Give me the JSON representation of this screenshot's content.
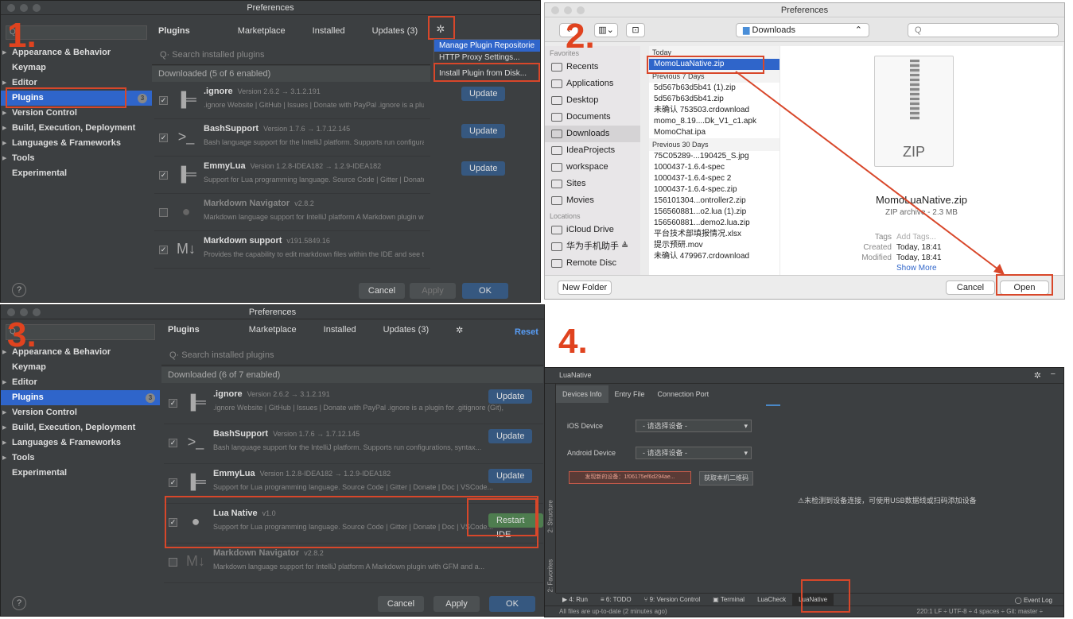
{
  "steps": {
    "s1": "1.",
    "s2": "2.",
    "s3": "3.",
    "s4": "4."
  },
  "prefs1": {
    "title": "Preferences",
    "search_placeholder": "Q",
    "sidebar": [
      {
        "label": "Appearance & Behavior",
        "arrow": true
      },
      {
        "label": "Keymap",
        "arrow": false
      },
      {
        "label": "Editor",
        "arrow": true
      },
      {
        "label": "Plugins",
        "arrow": false,
        "selected": true,
        "badge": "3"
      },
      {
        "label": "Version Control",
        "arrow": true
      },
      {
        "label": "Build, Execution, Deployment",
        "arrow": true
      },
      {
        "label": "Languages & Frameworks",
        "arrow": true
      },
      {
        "label": "Tools",
        "arrow": true
      },
      {
        "label": "Experimental",
        "arrow": false
      }
    ],
    "tabs": {
      "plugins": "Plugins",
      "marketplace": "Marketplace",
      "installed": "Installed",
      "updates": "Updates (3)"
    },
    "menu": [
      "Manage Plugin Repositorie",
      "HTTP Proxy Settings...",
      "Install Plugin from Disk..."
    ],
    "search": "Q· Search installed plugins",
    "subheader": "Downloaded (5 of 6 enabled)",
    "plugins": [
      {
        "name": ".ignore",
        "version": "Version 2.6.2 → 3.1.2.191",
        "desc": ".ignore Website | GitHub | Issues | Donate with PayPal .ignore is a plugin for .gitignore (Git),",
        "update": "Update",
        "checked": "✓"
      },
      {
        "name": "BashSupport",
        "version": "Version 1.7.6 → 1.7.12.145",
        "desc": "Bash language support for the IntelliJ platform. Supports run configurations, syntax...",
        "update": "Update",
        "checked": "✓"
      },
      {
        "name": "EmmyLua",
        "version": "Version 1.2.8-IDEA182 → 1.2.9-IDEA182",
        "desc": "Support for Lua programming language. Source Code | Gitter | Donate | Doc | VSCode...",
        "update": "Update",
        "checked": "✓"
      },
      {
        "name": "Markdown Navigator",
        "version": "v2.8.2",
        "desc": "Markdown language support for IntelliJ platform A Markdown plugin with GFM and a...",
        "update": "",
        "checked": ""
      },
      {
        "name": "Markdown support",
        "version": "v191.5849.16",
        "desc": "Provides the capability to edit markdown files within the IDE and see the rendered HTML in",
        "update": "",
        "checked": "✓"
      }
    ],
    "help": "?",
    "cancel": "Cancel",
    "apply": "Apply",
    "ok": "OK"
  },
  "finder": {
    "title": "Preferences",
    "location": "Downloads",
    "search_icon": "Q",
    "favorites_hd": "Favorites",
    "favorites": [
      "Recents",
      "Applications",
      "Desktop",
      "Documents",
      "Downloads",
      "IdeaProjects",
      "workspace",
      "Sites",
      "Movies"
    ],
    "locations_hd": "Locations",
    "locations": [
      "iCloud Drive",
      "华为手机助手 ≜",
      "Remote Disc"
    ],
    "today_hd": "Today",
    "today": [
      "MomoLuaNative.zip"
    ],
    "week_hd": "Previous 7 Days",
    "week": [
      "5d567b63d5b41 (1).zip",
      "5d567b63d5b41.zip",
      "未确认 753503.crdownload",
      "momo_8.19....Dk_V1_c1.apk",
      "MomoChat.ipa"
    ],
    "month_hd": "Previous 30 Days",
    "month": [
      "75C05289-...190425_S.jpg",
      "1000437-1.6.4-spec",
      "1000437-1.6.4-spec 2",
      "1000437-1.6.4-spec.zip",
      "156101304...ontroller2.zip",
      "156560881...o2.lua (1).zip",
      "156560881...demo2.lua.zip",
      "平台技术部填报情况.xlsx",
      "提示预研.mov",
      "未确认 479967.crdownload"
    ],
    "preview_label": "ZIP",
    "preview_name": "MomoLuaNative.zip",
    "preview_kind": "ZIP archive - 2.3 MB",
    "tags_k": "Tags",
    "tags_v": "Add Tags...",
    "created_k": "Created",
    "created_v": "Today, 18:41",
    "modified_k": "Modified",
    "modified_v": "Today, 18:41",
    "show_more": "Show More",
    "new_folder": "New Folder",
    "cancel": "Cancel",
    "open": "Open"
  },
  "prefs3": {
    "title": "Preferences",
    "search_placeholder": "Q",
    "sidebar": [
      {
        "label": "Appearance & Behavior",
        "arrow": true
      },
      {
        "label": "Keymap",
        "arrow": false
      },
      {
        "label": "Editor",
        "arrow": true
      },
      {
        "label": "Plugins",
        "arrow": false,
        "selected": true,
        "badge": "3"
      },
      {
        "label": "Version Control",
        "arrow": true
      },
      {
        "label": "Build, Execution, Deployment",
        "arrow": true
      },
      {
        "label": "Languages & Frameworks",
        "arrow": true
      },
      {
        "label": "Tools",
        "arrow": true
      },
      {
        "label": "Experimental",
        "arrow": false
      }
    ],
    "tabs": {
      "plugins": "Plugins",
      "marketplace": "Marketplace",
      "installed": "Installed",
      "updates": "Updates (3)",
      "reset": "Reset"
    },
    "search": "Q· Search installed plugins",
    "subheader": "Downloaded (6 of 7 enabled)",
    "plugins": [
      {
        "name": ".ignore",
        "version": "Version 2.6.2 → 3.1.2.191",
        "desc": ".ignore Website | GitHub | Issues | Donate with PayPal .ignore is a plugin for .gitignore (Git),",
        "update": "Update",
        "checked": "✓"
      },
      {
        "name": "BashSupport",
        "version": "Version 1.7.6 → 1.7.12.145",
        "desc": "Bash language support for the IntelliJ platform. Supports run configurations, syntax...",
        "update": "Update",
        "checked": "✓"
      },
      {
        "name": "EmmyLua",
        "version": "Version 1.2.8-IDEA182 → 1.2.9-IDEA182",
        "desc": "Support for Lua programming language. Source Code | Gitter | Donate | Doc | VSCode...",
        "update": "Update",
        "checked": "✓"
      },
      {
        "name": "Lua Native",
        "version": "v1.0",
        "desc": "Support for Lua programming language. Source Code | Gitter | Donate | Doc | VSCode...",
        "update": "Restart IDE",
        "checked": "✓"
      },
      {
        "name": "Markdown Navigator",
        "version": "v2.8.2",
        "desc": "Markdown language support for IntelliJ platform A Markdown plugin with GFM and a...",
        "update": "",
        "checked": ""
      }
    ],
    "help": "?",
    "cancel": "Cancel",
    "apply": "Apply",
    "ok": "OK"
  },
  "luanative": {
    "title": "LuaNative",
    "tabs": [
      "Devices Info",
      "Entry File",
      "Connection Port"
    ],
    "ios_label": "iOS Device",
    "ios_value": "- 请选择设备 -",
    "android_label": "Android Device",
    "android_value": "- 请选择设备 -",
    "found_btn": "发现新的设备：1f06175ef6d294ae...",
    "qr_btn": "获取本机二维码",
    "message": "⚠未检测到设备连接，可使用USB数据线或扫码添加设备",
    "left_tabs": [
      "2: Structure",
      "2: Favorites"
    ],
    "bottom_tabs": [
      "▶ 4: Run",
      "≡ 6: TODO",
      "⑂ 9: Version Control",
      "▣ Terminal",
      "LuaCheck",
      "LuaNative"
    ],
    "event_log": "◯ Event Log",
    "status_left": "All files are up-to-date (2 minutes ago)",
    "status_right": "220:1  LF ÷  UTF-8 ÷  4 spaces ÷  Git: master ÷"
  },
  "colors": {
    "accent": "#2f65ca",
    "highlight": "#d8472a",
    "update": "#365880",
    "restart": "#4e7d4f"
  }
}
